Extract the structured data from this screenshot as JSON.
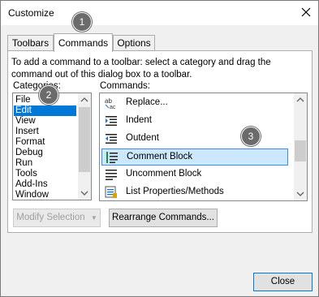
{
  "window": {
    "title": "Customize"
  },
  "tabs": [
    {
      "label": "Toolbars"
    },
    {
      "label": "Commands"
    },
    {
      "label": "Options"
    }
  ],
  "hint_text": "To add a command to a toolbar: select a category and drag the command out of this dialog box to a toolbar.",
  "categories": {
    "label": "Categories:",
    "items": [
      "File",
      "Edit",
      "View",
      "Insert",
      "Format",
      "Debug",
      "Run",
      "Tools",
      "Add-Ins",
      "Window"
    ],
    "selected": "Edit"
  },
  "commands": {
    "label": "Commands:",
    "items": [
      {
        "label": "Replace...",
        "icon": "replace-icon"
      },
      {
        "label": "Indent",
        "icon": "indent-icon"
      },
      {
        "label": "Outdent",
        "icon": "outdent-icon"
      },
      {
        "label": "Comment Block",
        "icon": "comment-block-icon"
      },
      {
        "label": "Uncomment Block",
        "icon": "uncomment-block-icon"
      },
      {
        "label": "List Properties/Methods",
        "icon": "list-properties-icon"
      }
    ],
    "selected": "Comment Block"
  },
  "buttons": {
    "modify_selection": "Modify Selection",
    "rearrange": "Rearrange Commands...",
    "close": "Close"
  },
  "badges": [
    "1",
    "2",
    "3"
  ],
  "colors": {
    "selection": "#0078d7",
    "command_highlight": "#cce8ff",
    "badge": "#6b6b6b"
  }
}
